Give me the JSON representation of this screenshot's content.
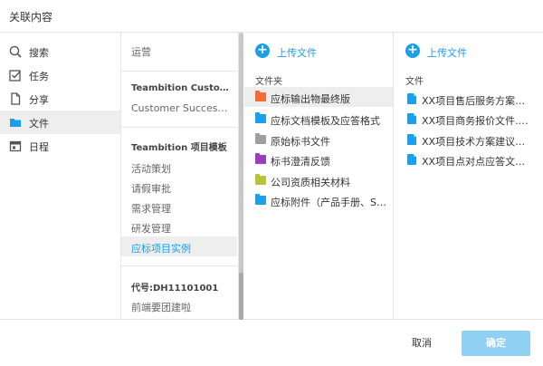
{
  "dialog": {
    "title": "关联内容"
  },
  "nav": {
    "items": [
      {
        "label": "搜索",
        "icon": "search-icon"
      },
      {
        "label": "任务",
        "icon": "checkbox-icon"
      },
      {
        "label": "分享",
        "icon": "document-icon"
      },
      {
        "label": "文件",
        "icon": "folder-icon",
        "active": true
      },
      {
        "label": "日程",
        "icon": "calendar-icon"
      }
    ]
  },
  "projects": {
    "top_item": "运营",
    "group1_header": "Teambition Customer Success",
    "group1_items": [
      "Customer Success Projects"
    ],
    "group2_header": "Teambition 项目模板",
    "group2_items": [
      "活动策划",
      "请假审批",
      "需求管理",
      "研发管理",
      "应标项目实例"
    ],
    "selected": "应标项目实例",
    "group3_header": "代号:DH11101001",
    "group3_items": [
      "前端要团建啦"
    ]
  },
  "folders": {
    "upload_label": "上传文件",
    "section_label": "文件夹",
    "items": [
      {
        "label": "应标输出物最终版",
        "color": "#f26b3a",
        "selected": true
      },
      {
        "label": "应标文档模板及应答格式",
        "color": "#1a9fe8"
      },
      {
        "label": "原始标书文件",
        "color": "#9e9e9e"
      },
      {
        "label": "标书澄清反馈",
        "color": "#9b3fbf"
      },
      {
        "label": "公司资质相关材料",
        "color": "#b5c43a"
      },
      {
        "label": "应标附件（产品手册、SLA）",
        "color": "#1a9fe8"
      }
    ]
  },
  "files": {
    "upload_label": "上传文件",
    "section_label": "文件",
    "items": [
      {
        "label": "XX项目售后服务方案建议书.docx"
      },
      {
        "label": "XX项目商务报价文件.docx"
      },
      {
        "label": "XX项目技术方案建议书.docx"
      },
      {
        "label": "XX项目点对点应答文件.docx"
      }
    ]
  },
  "footer": {
    "cancel_label": "取消",
    "confirm_label": "确定"
  },
  "colors": {
    "accent": "#1a9fe8",
    "confirm_bg": "#8fd0f3",
    "selected_bg": "#eeeeee"
  }
}
